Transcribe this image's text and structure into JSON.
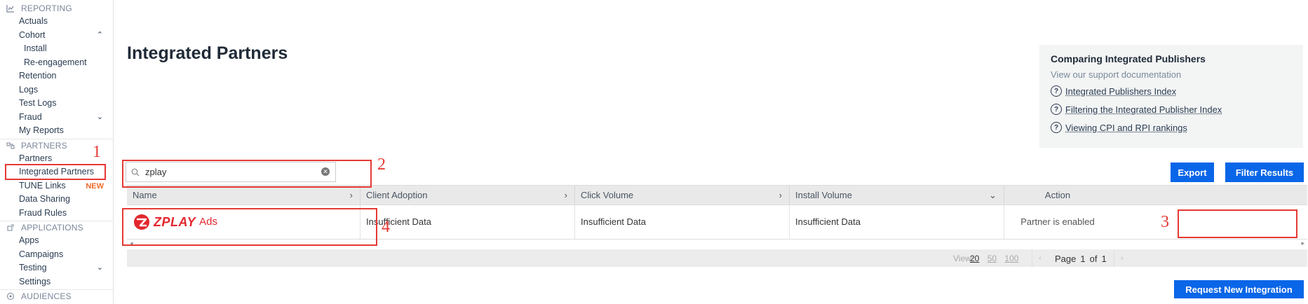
{
  "sidebar": {
    "reporting": {
      "section": "REPORTING",
      "items": [
        "Actuals",
        "Cohort",
        "Install",
        "Re-engagement",
        "Retention",
        "Logs",
        "Test Logs",
        "Fraud",
        "My Reports"
      ]
    },
    "partners": {
      "section": "PARTNERS",
      "items": [
        "Partners",
        "Integrated Partners",
        "TUNE Links",
        "Data Sharing",
        "Fraud Rules"
      ],
      "new_tag": "NEW"
    },
    "applications": {
      "section": "APPLICATIONS",
      "items": [
        "Apps",
        "Campaigns",
        "Testing",
        "Settings"
      ]
    },
    "audiences": {
      "section": "AUDIENCES"
    }
  },
  "page": {
    "title": "Integrated Partners"
  },
  "info": {
    "title": "Comparing Integrated Publishers",
    "subtitle": "View our support documentation",
    "links": [
      "Integrated Publishers Index",
      "Filtering the Integrated Publisher Index",
      "Viewing CPI and RPI rankings"
    ]
  },
  "search": {
    "value": "zplay"
  },
  "buttons": {
    "export": "Export",
    "filter": "Filter Results",
    "request": "Request New Integration"
  },
  "table": {
    "columns": [
      "Name",
      "Client Adoption",
      "Click Volume",
      "Install Volume",
      "Action"
    ],
    "rows": [
      {
        "logo_text": "ZPLAY",
        "logo_suffix": "Ads",
        "client_adoption": "Insufficient Data",
        "click_volume": "Insufficient Data",
        "install_volume": "Insufficient Data",
        "action": "Partner is enabled"
      }
    ]
  },
  "pager": {
    "view_label": "View:",
    "sizes": [
      "20",
      "50",
      "100"
    ],
    "page_label": "Page",
    "page": "1",
    "of_label": "of",
    "total": "1"
  },
  "annotations": [
    "1",
    "2",
    "3",
    "4"
  ],
  "colors": {
    "accent": "#0a66e8",
    "annotation": "#e53935",
    "brand": "#e3262d"
  }
}
